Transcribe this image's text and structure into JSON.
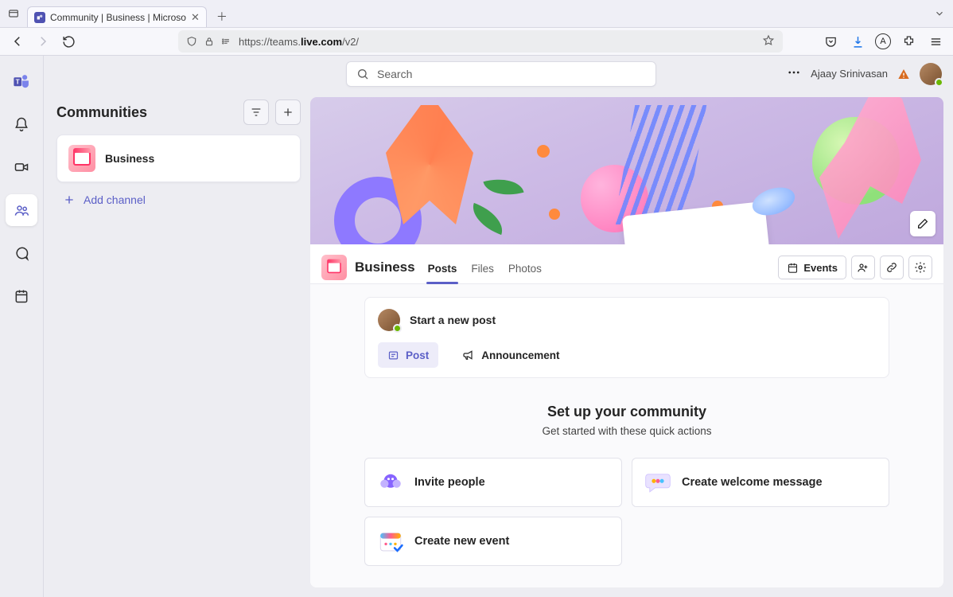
{
  "browser": {
    "tab_title": "Community | Business | Microso",
    "url_prefix": "https://teams.",
    "url_host": "live.com",
    "url_path": "/v2/",
    "account_letter": "A"
  },
  "app_top": {
    "search_placeholder": "Search",
    "user_name": "Ajaay Srinivasan"
  },
  "sidebar": {
    "title": "Communities",
    "community_name": "Business",
    "add_channel_label": "Add channel"
  },
  "main": {
    "community_name": "Business",
    "tabs": [
      "Posts",
      "Files",
      "Photos"
    ],
    "active_tab": 0,
    "events_label": "Events"
  },
  "compose": {
    "start_label": "Start a new post",
    "post_label": "Post",
    "announcement_label": "Announcement"
  },
  "setup": {
    "heading": "Set up your community",
    "subheading": "Get started with these quick actions",
    "cards": {
      "invite": "Invite people",
      "welcome": "Create welcome message",
      "event": "Create new event"
    }
  }
}
